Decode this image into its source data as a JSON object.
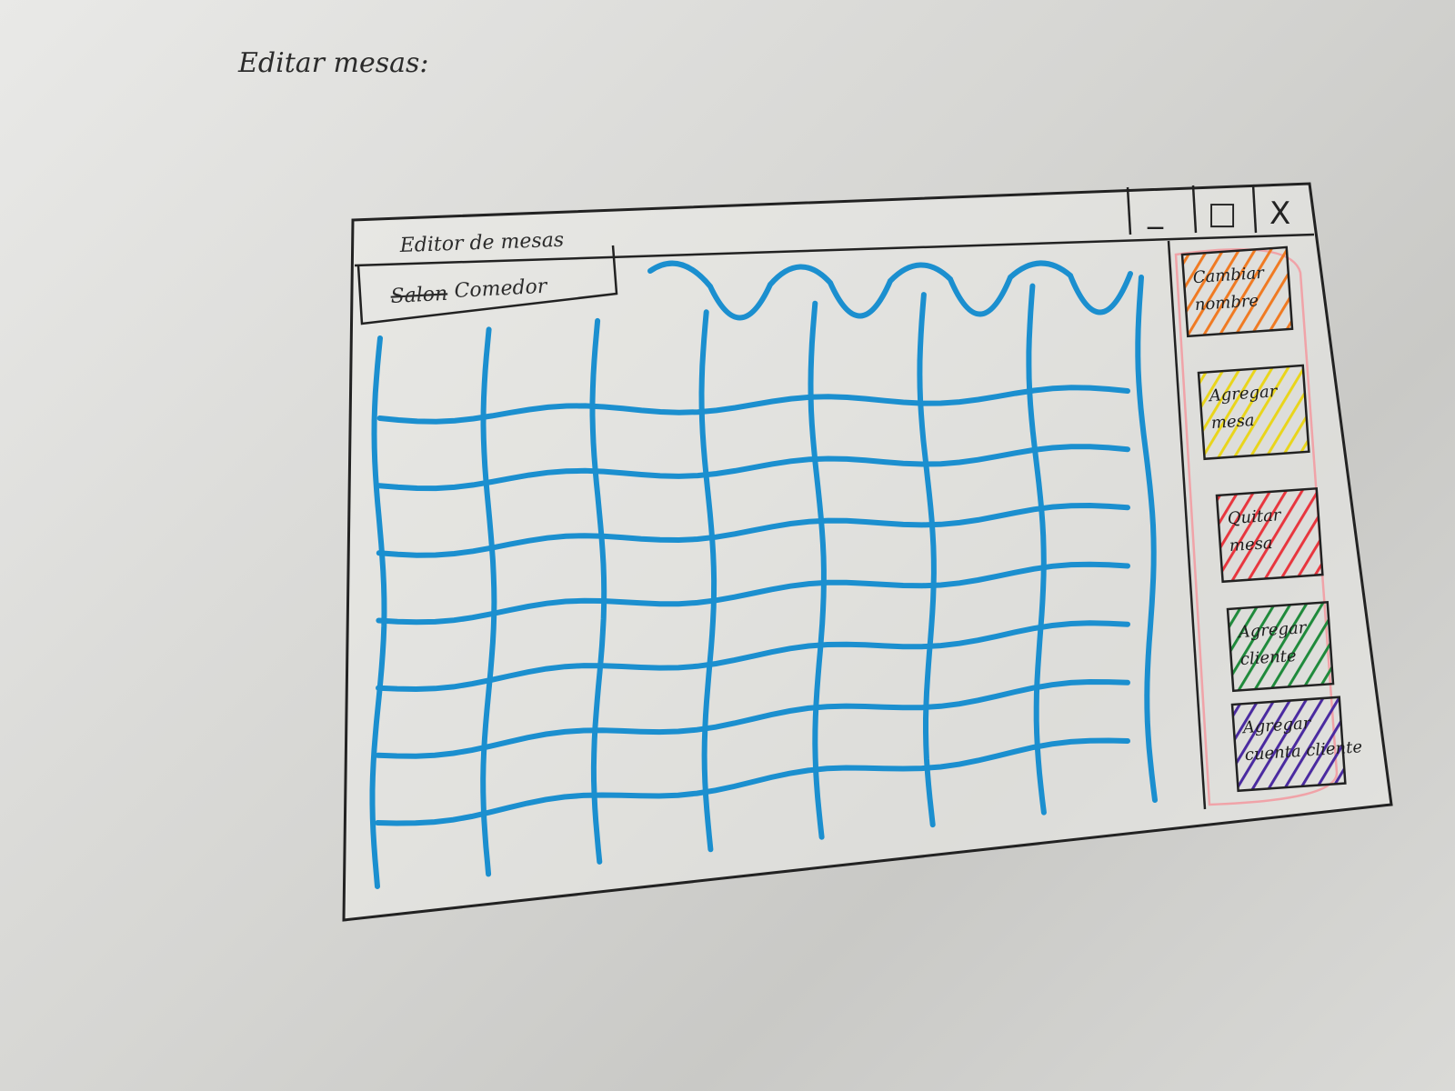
{
  "page_caption": "Editar mesas:",
  "window": {
    "title": "Editor de mesas",
    "controls": {
      "minimize": "_",
      "maximize": "□",
      "close": "X"
    }
  },
  "tab": {
    "strike_text": "Salon",
    "label": "Comedor"
  },
  "grid": {
    "color": "#1b8fcf",
    "columns": 8,
    "rows": 7
  },
  "sidebar": {
    "border_color": "#f0a3a8",
    "buttons": [
      {
        "line1": "Cambiar",
        "line2": "nombre",
        "color": "#f07a22"
      },
      {
        "line1": "Agregar",
        "line2": "mesa",
        "color": "#e9d51b"
      },
      {
        "line1": "Quitar",
        "line2": "mesa",
        "color": "#e8363e"
      },
      {
        "line1": "Agregar",
        "line2": "cliente",
        "color": "#1f8a3b"
      },
      {
        "line1": "Agregar",
        "line2": "cuenta cliente",
        "color": "#4a2aa0"
      }
    ]
  }
}
